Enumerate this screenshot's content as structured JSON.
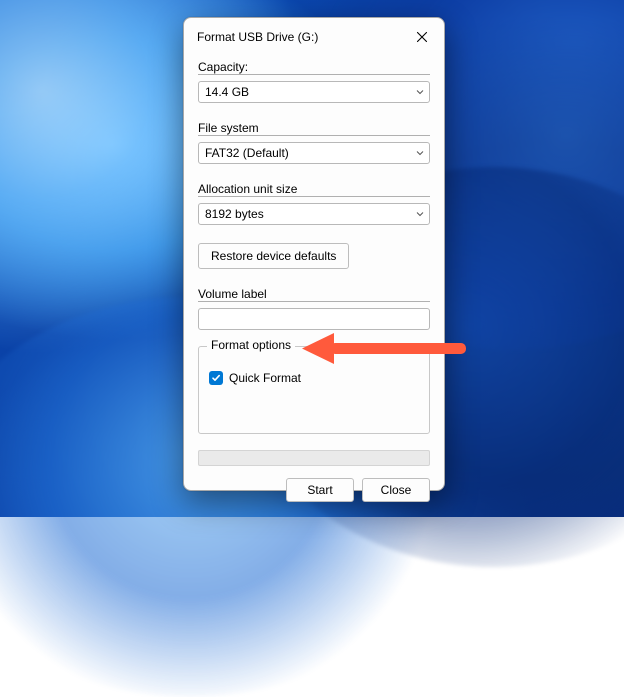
{
  "window": {
    "title": "Format USB Drive (G:)"
  },
  "capacity": {
    "label": "Capacity:",
    "value": "14.4 GB"
  },
  "filesystem": {
    "label": "File system",
    "value": "FAT32 (Default)"
  },
  "allocation": {
    "label": "Allocation unit size",
    "value": "8192 bytes"
  },
  "restore": {
    "label": "Restore device defaults"
  },
  "volume": {
    "label": "Volume label",
    "value": ""
  },
  "format_options": {
    "legend": "Format options",
    "quick_format": {
      "label": "Quick Format",
      "checked": true
    }
  },
  "buttons": {
    "start": "Start",
    "close": "Close"
  },
  "colors": {
    "accent": "#0078d4",
    "arrow": "#ff5a3c"
  }
}
